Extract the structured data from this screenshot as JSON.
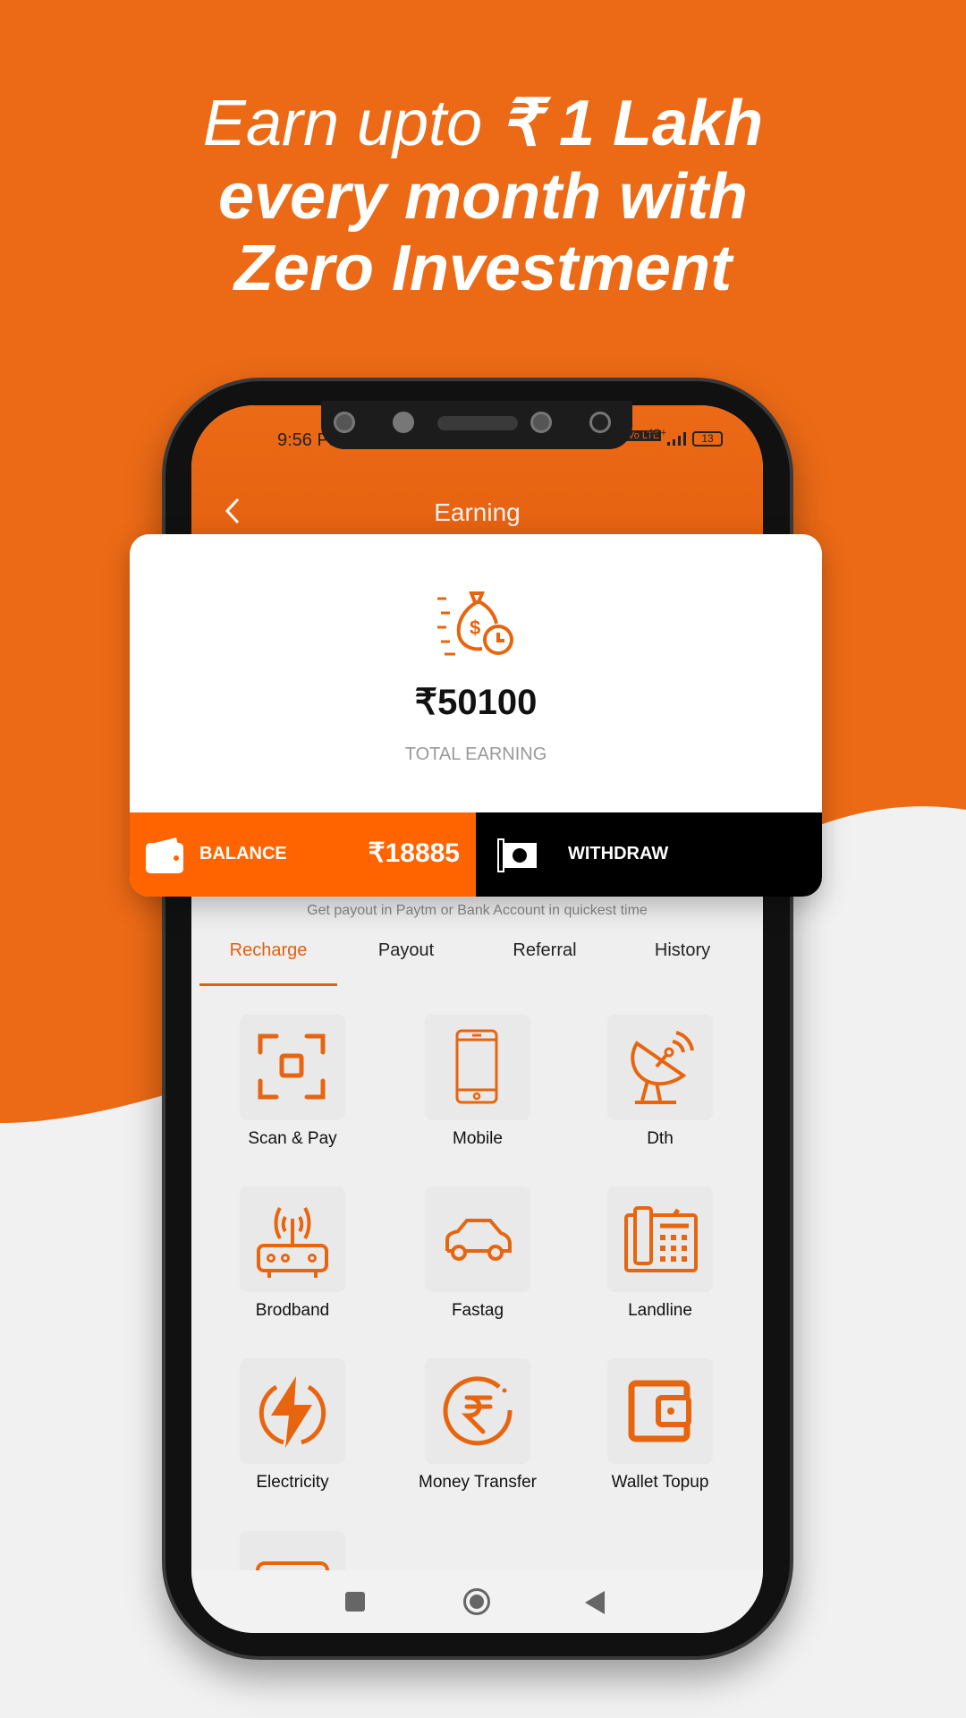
{
  "headline": {
    "line1_a": "Earn upto ",
    "line1_b": "₹ 1 Lakh",
    "line2": "every month with",
    "line3": "Zero Investment"
  },
  "colors": {
    "brand_orange": "#EC6A16",
    "balance_orange": "#FF6400",
    "icon_orange": "#E8650F"
  },
  "status_bar": {
    "time": "9:56 PM",
    "network": "4G+",
    "volte": "Vo LTE",
    "battery": "13"
  },
  "header": {
    "title": "Earning",
    "back_icon": "chevron-left-icon"
  },
  "earning_card": {
    "icon": "money-bag-clock-icon",
    "amount": "₹50100",
    "label": "TOTAL EARNING"
  },
  "balance": {
    "label": "BALANCE",
    "amount": "₹18885",
    "icon": "wallet-icon"
  },
  "withdraw": {
    "label": "WITHDRAW",
    "icon": "cash-icon"
  },
  "payout_note": "Get payout in Paytm or Bank Account in quickest time",
  "tabs": [
    {
      "label": "Recharge",
      "active": true
    },
    {
      "label": "Payout"
    },
    {
      "label": "Referral"
    },
    {
      "label": "History"
    }
  ],
  "services": [
    {
      "label": "Scan & Pay",
      "icon": "scan-icon"
    },
    {
      "label": "Mobile",
      "icon": "mobile-icon"
    },
    {
      "label": "Dth",
      "icon": "satellite-dish-icon"
    },
    {
      "label": "Brodband",
      "icon": "router-icon"
    },
    {
      "label": "Fastag",
      "icon": "car-icon"
    },
    {
      "label": "Landline",
      "icon": "telephone-icon"
    },
    {
      "label": "Electricity",
      "icon": "lightning-icon"
    },
    {
      "label": "Money Transfer",
      "icon": "rupee-icon"
    },
    {
      "label": "Wallet Topup",
      "icon": "wallet-icon"
    }
  ],
  "nav": {
    "recent": "square-icon",
    "home": "circle-icon",
    "back": "triangle-back-icon"
  }
}
